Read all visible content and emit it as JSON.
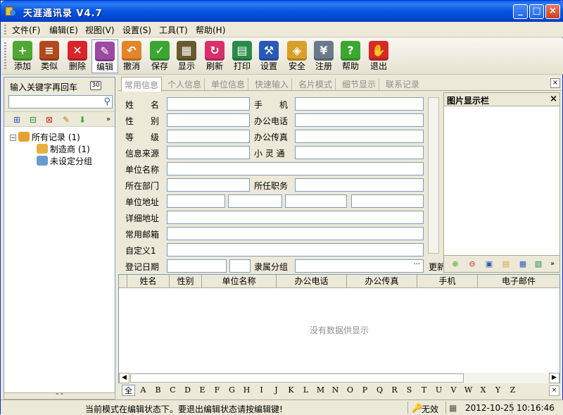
{
  "window": {
    "title": "天涯通讯录 V4.7"
  },
  "menu": [
    "文件(F)",
    "编辑(E)",
    "视图(V)",
    "设置(S)",
    "工具(T)",
    "帮助(H)"
  ],
  "toolbar": [
    {
      "label": "添加",
      "icon": "add-contact-icon",
      "color": "#4ea832"
    },
    {
      "label": "类似",
      "icon": "similar-icon",
      "color": "#b04a1e"
    },
    {
      "label": "删除",
      "icon": "delete-icon",
      "color": "#d8242a"
    },
    {
      "label": "编辑",
      "icon": "edit-icon",
      "color": "#9a4aa0"
    },
    {
      "label": "撤消",
      "icon": "undo-icon",
      "color": "#e4852a"
    },
    {
      "label": "保存",
      "icon": "save-check-icon",
      "color": "#3aa830"
    },
    {
      "label": "显示",
      "icon": "display-grid-icon",
      "color": "#6a5a30"
    },
    {
      "label": "刷新",
      "icon": "refresh-icon",
      "color": "#d8306a"
    },
    {
      "label": "打印",
      "icon": "print-icon",
      "color": "#2a8a4a"
    },
    {
      "label": "设置",
      "icon": "settings-tools-icon",
      "color": "#2a5ab8"
    },
    {
      "label": "安全",
      "icon": "shield-icon",
      "color": "#d8a028"
    },
    {
      "label": "注册",
      "icon": "register-yen-icon",
      "color": "#6a7a8a"
    },
    {
      "label": "帮助",
      "icon": "help-icon",
      "color": "#3aa830"
    },
    {
      "label": "退出",
      "icon": "exit-hand-icon",
      "color": "#d82828"
    }
  ],
  "left": {
    "search_label": "输入关键字再回车",
    "search_value": "",
    "badge": "30",
    "tree": [
      {
        "label": "所有记录 (1)"
      },
      {
        "label": "制造商 (1)"
      },
      {
        "label": "未设定分组"
      }
    ],
    "collapse": "⌃⌃"
  },
  "tabs": [
    "常用信息",
    "个人信息",
    "单位信息",
    "快速输入",
    "名片模式",
    "细节显示",
    "联系记录"
  ],
  "form": {
    "name": "姓　　名",
    "mobile": "手　　机",
    "gender": "性　　别",
    "office_phone": "办公电话",
    "level": "等　　级",
    "office_fax": "办公传真",
    "source": "信息来源",
    "xlt": "小 灵 通",
    "company": "单位名称",
    "department": "所在部门",
    "position": "所任职务",
    "address": "单位地址",
    "detail_address": "详细地址",
    "email": "常用邮箱",
    "custom1": "自定义1",
    "reg_date": "登记日期",
    "group": "隶属分组",
    "group_btn": "···",
    "update": "更新"
  },
  "image_panel": {
    "title": "图片显示栏"
  },
  "grid": {
    "columns": [
      "姓名",
      "性别",
      "单位名称",
      "办公电话",
      "办公传真",
      "手机",
      "电子邮件"
    ],
    "empty": "没有数据供显示"
  },
  "alphabet": [
    "全",
    "A",
    "B",
    "C",
    "D",
    "E",
    "F",
    "G",
    "H",
    "I",
    "J",
    "K",
    "L",
    "M",
    "N",
    "O",
    "P",
    "Q",
    "R",
    "S",
    "T",
    "U",
    "V",
    "W",
    "X",
    "Y",
    "Z"
  ],
  "status": {
    "message": "当前模式在编辑状态下。要退出编辑状态请按编辑键!",
    "state": "无效",
    "date": "2012-10-25",
    "time": "10:16:46"
  },
  "colors": {
    "titlebar": "#0554e0",
    "selection": "#316ac5"
  }
}
